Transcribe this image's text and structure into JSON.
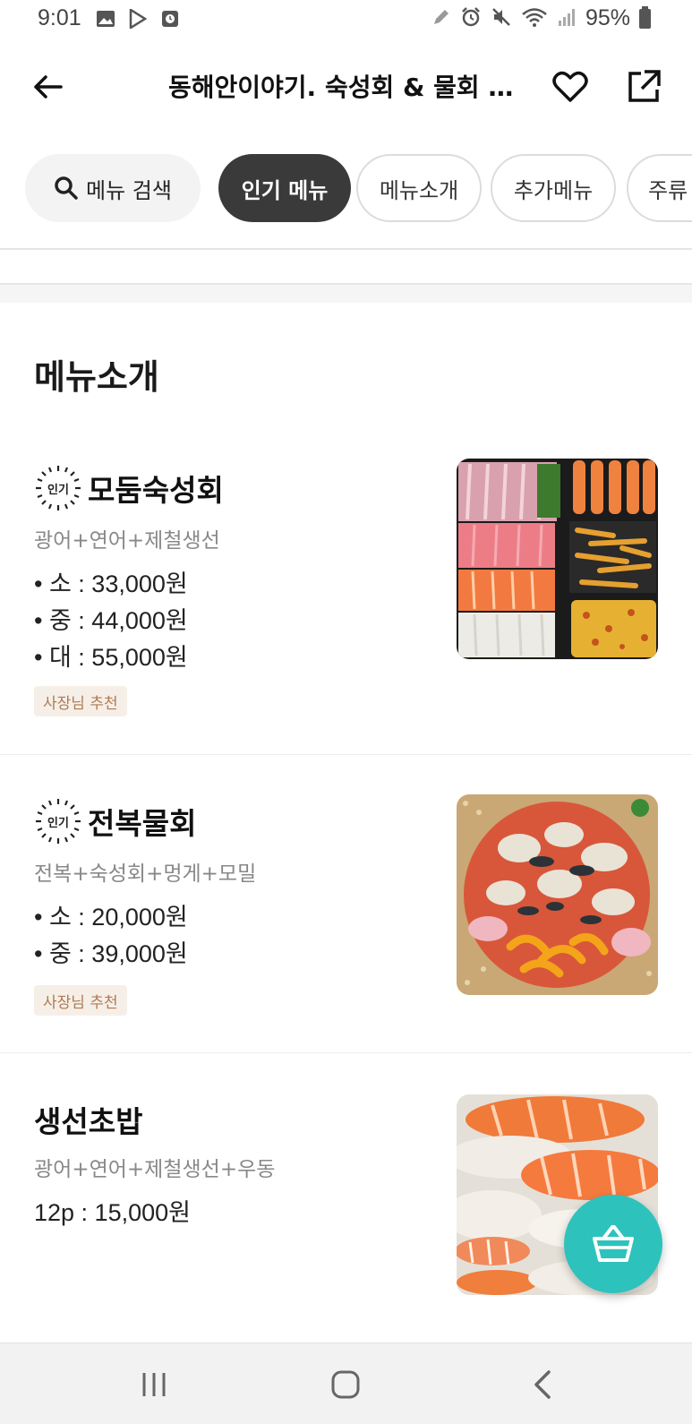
{
  "status_bar": {
    "time": "9:01",
    "battery": "95%"
  },
  "header": {
    "title": "동해안이야기. 숙성회 & 물회 전..."
  },
  "chips": {
    "search": "메뉴 검색",
    "popular": "인기 메뉴",
    "intro": "메뉴소개",
    "extra": "추가메뉴",
    "drinks": "주류"
  },
  "section": {
    "title": "메뉴소개"
  },
  "badge_label": "인기",
  "items": [
    {
      "name": "모둠숙성회",
      "desc": "광어+연어+제철생선",
      "prices": [
        "• 소 : 33,000원",
        "• 중 : 44,000원",
        "• 대 : 55,000원"
      ],
      "tag": "사장님 추천"
    },
    {
      "name": "전복물회",
      "desc": "전복+숙성회+멍게+모밀",
      "prices": [
        "• 소 : 20,000원",
        "• 중 : 39,000원"
      ],
      "tag": "사장님 추천"
    },
    {
      "name": "생선초밥",
      "desc": "광어+연어+제철생선+우동",
      "prices": [
        "12p : 15,000원"
      ]
    }
  ],
  "colors": {
    "accent": "#2ec2bd",
    "chip_active": "#3a3a3a",
    "tag_bg": "#f6efe8",
    "tag_text": "#b07a52"
  },
  "icons": [
    "back-arrow-icon",
    "heart-icon",
    "share-icon",
    "search-icon",
    "popular-badge-icon",
    "basket-icon",
    "recent-apps-icon",
    "home-icon",
    "nav-back-icon"
  ]
}
